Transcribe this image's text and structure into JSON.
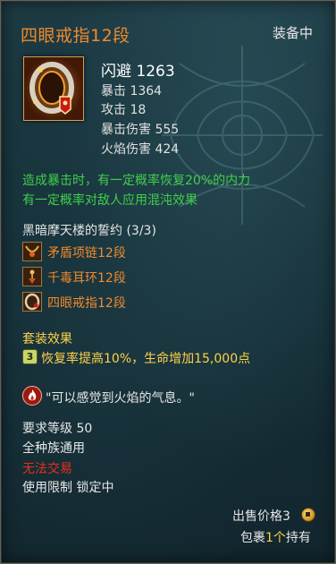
{
  "item": {
    "name": "四眼戒指12段",
    "status": "装备中",
    "icon": "ring-icon",
    "main_stat": "闪避 1263",
    "stats": [
      "暴击 1364",
      "攻击 18",
      "暴击伤害 555",
      "火焰伤害 424"
    ]
  },
  "effects": [
    "造成暴击时，有一定概率恢复20%的内力",
    "有一定概率对敌人应用混沌效果"
  ],
  "set": {
    "name": "黑暗摩天楼的誓约 (3/3)",
    "pieces": [
      {
        "label": "矛盾项链12段",
        "icon": "necklace-icon"
      },
      {
        "label": "千毒耳环12段",
        "icon": "earring-icon"
      },
      {
        "label": "四眼戒指12段",
        "icon": "ring-icon"
      }
    ],
    "bonus_title": "套装效果",
    "bonus_count": "3",
    "bonus_text": "恢复率提高10%，生命增加15,000点"
  },
  "flavor": {
    "icon": "fire-icon",
    "text": "\"可以感觉到火焰的气息。\""
  },
  "requirements": {
    "level": "要求等级 50",
    "race": "全种族通用",
    "trade": "无法交易",
    "limit": "使用限制 锁定中"
  },
  "footer": {
    "price_label": "出售价格3",
    "coin_icon": "coin-icon",
    "bag_prefix": "包裹",
    "bag_count": "1个",
    "bag_suffix": "持有"
  },
  "colors": {
    "title": "#f08a2c",
    "effect": "#3ed04a",
    "untradeable": "#e8301c",
    "highlight": "#ffd24a"
  }
}
